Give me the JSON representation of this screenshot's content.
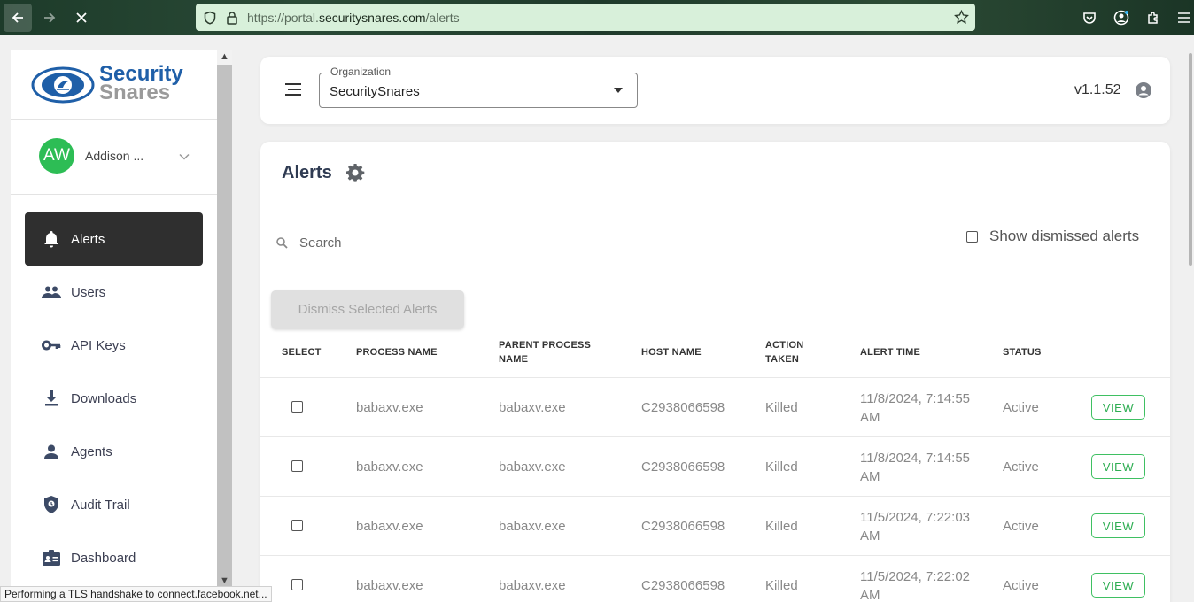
{
  "browser": {
    "url_prefix": "https://portal.",
    "url_domain": "securitysnares.com",
    "url_path": "/alerts",
    "status_text": "Performing a TLS handshake to connect.facebook.net..."
  },
  "sidebar": {
    "logo_line1": "Security",
    "logo_line2": "Snares",
    "user_initials": "AW",
    "user_name": "Addison ...",
    "items": [
      {
        "label": "Alerts",
        "icon": "bell-icon"
      },
      {
        "label": "Users",
        "icon": "users-icon"
      },
      {
        "label": "API Keys",
        "icon": "key-icon"
      },
      {
        "label": "Downloads",
        "icon": "download-icon"
      },
      {
        "label": "Agents",
        "icon": "person-icon"
      },
      {
        "label": "Audit Trail",
        "icon": "shield-icon"
      },
      {
        "label": "Dashboard",
        "icon": "dashboard-icon"
      }
    ]
  },
  "header": {
    "org_label": "Organization",
    "org_value": "SecuritySnares",
    "version": "v1.1.52"
  },
  "alerts": {
    "title": "Alerts",
    "search_placeholder": "Search",
    "show_dismissed_label": "Show dismissed alerts",
    "dismiss_button": "Dismiss Selected Alerts",
    "columns": {
      "select": "SELECT",
      "process": "PROCESS NAME",
      "parent": "PARENT PROCESS NAME",
      "host": "HOST NAME",
      "action": "ACTION TAKEN",
      "time": "ALERT TIME",
      "status": "STATUS"
    },
    "rows": [
      {
        "process": "babaxv.exe",
        "parent": "babaxv.exe",
        "host": "C2938066598",
        "action": "Killed",
        "time": "11/8/2024, 7:14:55 AM",
        "status": "Active",
        "view": "VIEW"
      },
      {
        "process": "babaxv.exe",
        "parent": "babaxv.exe",
        "host": "C2938066598",
        "action": "Killed",
        "time": "11/8/2024, 7:14:55 AM",
        "status": "Active",
        "view": "VIEW"
      },
      {
        "process": "babaxv.exe",
        "parent": "babaxv.exe",
        "host": "C2938066598",
        "action": "Killed",
        "time": "11/5/2024, 7:22:03 AM",
        "status": "Active",
        "view": "VIEW"
      },
      {
        "process": "babaxv.exe",
        "parent": "babaxv.exe",
        "host": "C2938066598",
        "action": "Killed",
        "time": "11/5/2024, 7:22:02 AM",
        "status": "Active",
        "view": "VIEW"
      }
    ]
  },
  "colors": {
    "accent_green": "#2dbd55",
    "active_nav_bg": "#2f2f2f",
    "logo_blue": "#1f5fa8",
    "logo_gray": "#9a9a9a"
  }
}
